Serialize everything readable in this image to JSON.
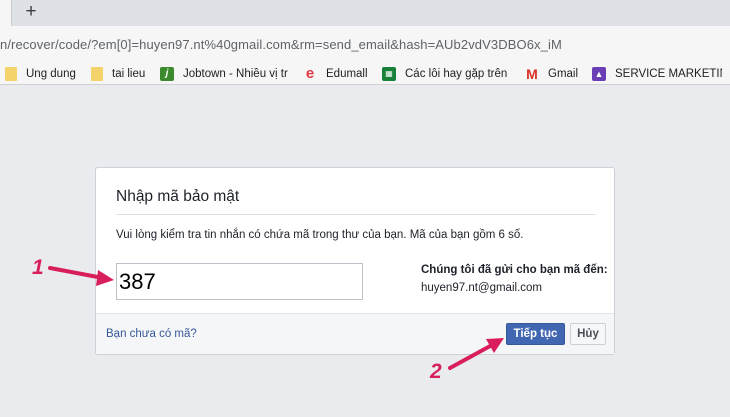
{
  "browser": {
    "new_tab_glyph": "+",
    "url": "n/recover/code/?em[0]=huyen97.nt%40gmail.com&rm=send_email&hash=AUb2vdV3DBO6x_iM"
  },
  "bookmarks": [
    {
      "label": "Ung dung",
      "icon": "folder-icon",
      "glyph": ""
    },
    {
      "label": "tai lieu",
      "icon": "folder-icon",
      "glyph": ""
    },
    {
      "label": "Jobtown - Nhiều vị trí",
      "icon": "jobtown-icon",
      "glyph": "j"
    },
    {
      "label": "Edumall",
      "icon": "edumall-icon",
      "glyph": "e"
    },
    {
      "label": "Các lỗi hay gặp trên t",
      "icon": "sheets-icon",
      "glyph": "▦"
    },
    {
      "label": "Gmail",
      "icon": "gmail-icon",
      "glyph": "M"
    },
    {
      "label": "SERVICE MARKETING",
      "icon": "service-icon",
      "glyph": "▲"
    }
  ],
  "dialog": {
    "title": "Nhập mã bảo mật",
    "description": "Vui lòng kiểm tra tin nhắn có chứa mã trong thư của bạn. Mã của bạn gồm 6 số.",
    "code_value": "387",
    "sent_label": "Chúng tôi đã gửi cho bạn mã đến:",
    "sent_email": "huyen97.nt@gmail.com",
    "no_code_link": "Bạn chưa có mã?",
    "continue_label": "Tiếp tục",
    "cancel_label": "Hủy"
  },
  "annotations": {
    "step1": "1",
    "step2": "2",
    "color": "#d81f5b"
  },
  "colors": {
    "primary_button": "#4267b2",
    "link": "#365899",
    "page_background": "#e9ebee"
  }
}
